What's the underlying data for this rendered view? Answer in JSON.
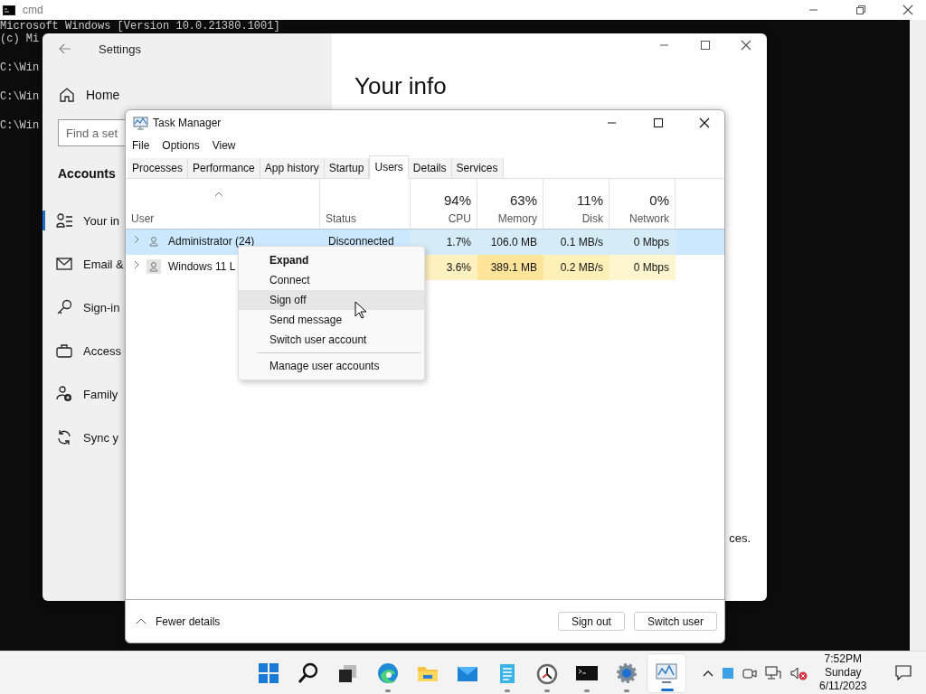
{
  "cmd_window": {
    "title": "cmd",
    "lines": [
      "Microsoft Windows [Version 10.0.21380.1001]",
      "(c) Mi",
      "C:\\Win",
      "C:\\Win",
      "C:\\Win"
    ]
  },
  "settings_window": {
    "title": "Settings",
    "home": "Home",
    "search": {
      "placeholder": "Find a set"
    },
    "section": "Accounts",
    "nav_items": [
      {
        "label": "Your in",
        "selected": true
      },
      {
        "label": "Email &",
        "selected": false
      },
      {
        "label": "Sign-in",
        "selected": false
      },
      {
        "label": "Access",
        "selected": false
      },
      {
        "label": "Family",
        "selected": false
      },
      {
        "label": "Sync y",
        "selected": false
      }
    ],
    "page_title": "Your info",
    "body_fragment": "ces."
  },
  "task_manager": {
    "title": "Task Manager",
    "menu": [
      "File",
      "Options",
      "View"
    ],
    "tabs": [
      {
        "label": "Processes",
        "selected": false
      },
      {
        "label": "Performance",
        "selected": false
      },
      {
        "label": "App history",
        "selected": false
      },
      {
        "label": "Startup",
        "selected": false
      },
      {
        "label": "Users",
        "selected": true
      },
      {
        "label": "Details",
        "selected": false
      },
      {
        "label": "Services",
        "selected": false
      }
    ],
    "columns": [
      {
        "label": "User"
      },
      {
        "label": "Status"
      },
      {
        "label": "CPU",
        "summary": "94%"
      },
      {
        "label": "Memory",
        "summary": "63%"
      },
      {
        "label": "Disk",
        "summary": "11%"
      },
      {
        "label": "Network",
        "summary": "0%"
      }
    ],
    "rows": [
      {
        "selected": true,
        "cells": [
          {
            "value": "Administrator (24)"
          },
          {
            "value": "Disconnected"
          },
          {
            "value": "1.7%",
            "color": "#d5ecf6"
          },
          {
            "value": "106.0 MB",
            "color": "#d5ecf6"
          },
          {
            "value": "0.1 MB/s",
            "color": "#d5ecf6"
          },
          {
            "value": "0 Mbps",
            "color": "#d5ecf6"
          }
        ]
      },
      {
        "selected": false,
        "cells": [
          {
            "value": "Windows 11 L"
          },
          {},
          {
            "value": "3.6%",
            "color": "#fff1c0"
          },
          {
            "value": "389.1 MB",
            "color": "#ffe49a"
          },
          {
            "value": "0.2 MB/s",
            "color": "#fff0b8"
          },
          {
            "value": "0 Mbps",
            "color": "#fff6cf"
          }
        ]
      }
    ],
    "context_menu": [
      {
        "kind": "item",
        "label": "Expand",
        "default": true,
        "selected": false
      },
      {
        "kind": "item",
        "label": "Connect",
        "default": false,
        "selected": false
      },
      {
        "kind": "item",
        "label": "Sign off",
        "default": false,
        "selected": true
      },
      {
        "kind": "item",
        "label": "Send message",
        "default": false,
        "selected": false
      },
      {
        "kind": "item",
        "label": "Switch user account",
        "default": false,
        "selected": false
      },
      {
        "kind": "separator"
      },
      {
        "kind": "item",
        "label": "Manage user accounts",
        "default": false,
        "selected": false
      }
    ],
    "fewer_details": "Fewer details",
    "buttons": [
      "Sign out",
      "Switch user"
    ]
  },
  "taskbar": {
    "apps": [
      {
        "running": false,
        "active": false
      },
      {
        "running": false,
        "active": false
      },
      {
        "running": false,
        "active": false
      },
      {
        "running": true,
        "active": false
      },
      {
        "running": false,
        "active": false
      },
      {
        "running": false,
        "active": false
      },
      {
        "running": true,
        "active": false
      },
      {
        "running": true,
        "active": false
      },
      {
        "running": true,
        "active": false
      },
      {
        "running": true,
        "active": false
      },
      {
        "running": true,
        "active": true
      }
    ],
    "clock": {
      "time": "7:52PM",
      "day": "Sunday",
      "date": "6/11/2023"
    }
  }
}
